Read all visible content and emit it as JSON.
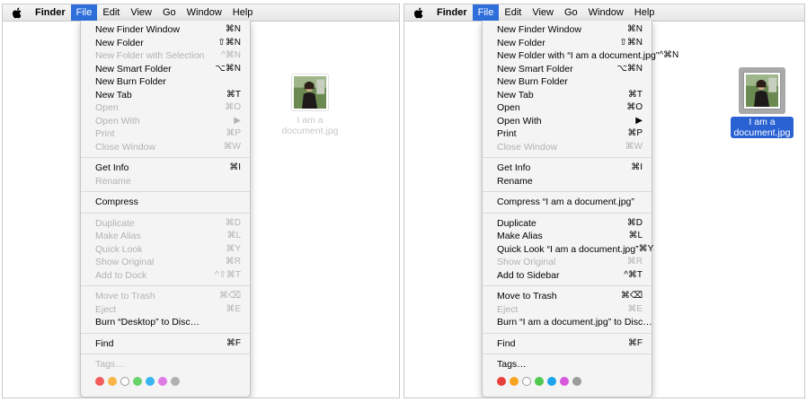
{
  "menubar": {
    "app": "Finder",
    "items": [
      "File",
      "Edit",
      "View",
      "Go",
      "Window",
      "Help"
    ]
  },
  "left": {
    "file_name_line1": "I am a",
    "file_name_line2": "document.jpg",
    "groups": [
      [
        {
          "label": "New Finder Window",
          "shortcut": "⌘N",
          "enabled": true
        },
        {
          "label": "New Folder",
          "shortcut": "⇧⌘N",
          "enabled": true
        },
        {
          "label": "New Folder with Selection",
          "shortcut": "^⌘N",
          "enabled": false
        },
        {
          "label": "New Smart Folder",
          "shortcut": "⌥⌘N",
          "enabled": true
        },
        {
          "label": "New Burn Folder",
          "shortcut": "",
          "enabled": true
        },
        {
          "label": "New Tab",
          "shortcut": "⌘T",
          "enabled": true
        },
        {
          "label": "Open",
          "shortcut": "⌘O",
          "enabled": false
        },
        {
          "label": "Open With",
          "shortcut": "▶",
          "enabled": false
        },
        {
          "label": "Print",
          "shortcut": "⌘P",
          "enabled": false
        },
        {
          "label": "Close Window",
          "shortcut": "⌘W",
          "enabled": false
        }
      ],
      [
        {
          "label": "Get Info",
          "shortcut": "⌘I",
          "enabled": true
        },
        {
          "label": "Rename",
          "shortcut": "",
          "enabled": false
        }
      ],
      [
        {
          "label": "Compress",
          "shortcut": "",
          "enabled": true
        }
      ],
      [
        {
          "label": "Duplicate",
          "shortcut": "⌘D",
          "enabled": false
        },
        {
          "label": "Make Alias",
          "shortcut": "⌘L",
          "enabled": false
        },
        {
          "label": "Quick Look",
          "shortcut": "⌘Y",
          "enabled": false
        },
        {
          "label": "Show Original",
          "shortcut": "⌘R",
          "enabled": false
        },
        {
          "label": "Add to Dock",
          "shortcut": "^⇧⌘T",
          "enabled": false
        }
      ],
      [
        {
          "label": "Move to Trash",
          "shortcut": "⌘⌫",
          "enabled": false
        },
        {
          "label": "Eject",
          "shortcut": "⌘E",
          "enabled": false
        },
        {
          "label": "Burn “Desktop” to Disc…",
          "shortcut": "",
          "enabled": true
        }
      ],
      [
        {
          "label": "Find",
          "shortcut": "⌘F",
          "enabled": true
        }
      ],
      [
        {
          "label": "Tags…",
          "shortcut": "",
          "enabled": false
        }
      ]
    ],
    "tag_colors": [
      "#f25c5c",
      "#f8b64a",
      "#ffffff",
      "#6ad36a",
      "#38b5f0",
      "#e07be6",
      "#b0b0b0"
    ]
  },
  "right": {
    "file_name_line1": "I am a",
    "file_name_line2": "document.jpg",
    "groups": [
      [
        {
          "label": "New Finder Window",
          "shortcut": "⌘N",
          "enabled": true
        },
        {
          "label": "New Folder",
          "shortcut": "⇧⌘N",
          "enabled": true
        },
        {
          "label": "New Folder with “I am a document.jpg”",
          "shortcut": "^⌘N",
          "enabled": true
        },
        {
          "label": "New Smart Folder",
          "shortcut": "⌥⌘N",
          "enabled": true
        },
        {
          "label": "New Burn Folder",
          "shortcut": "",
          "enabled": true
        },
        {
          "label": "New Tab",
          "shortcut": "⌘T",
          "enabled": true
        },
        {
          "label": "Open",
          "shortcut": "⌘O",
          "enabled": true
        },
        {
          "label": "Open With",
          "shortcut": "▶",
          "enabled": true
        },
        {
          "label": "Print",
          "shortcut": "⌘P",
          "enabled": true
        },
        {
          "label": "Close Window",
          "shortcut": "⌘W",
          "enabled": false
        }
      ],
      [
        {
          "label": "Get Info",
          "shortcut": "⌘I",
          "enabled": true
        },
        {
          "label": "Rename",
          "shortcut": "",
          "enabled": true
        }
      ],
      [
        {
          "label": "Compress “I am a document.jpg”",
          "shortcut": "",
          "enabled": true
        }
      ],
      [
        {
          "label": "Duplicate",
          "shortcut": "⌘D",
          "enabled": true
        },
        {
          "label": "Make Alias",
          "shortcut": "⌘L",
          "enabled": true
        },
        {
          "label": "Quick Look “I am a document.jpg”",
          "shortcut": "⌘Y",
          "enabled": true
        },
        {
          "label": "Show Original",
          "shortcut": "⌘R",
          "enabled": false
        },
        {
          "label": "Add to Sidebar",
          "shortcut": "^⌘T",
          "enabled": true
        }
      ],
      [
        {
          "label": "Move to Trash",
          "shortcut": "⌘⌫",
          "enabled": true
        },
        {
          "label": "Eject",
          "shortcut": "⌘E",
          "enabled": false
        },
        {
          "label": "Burn “I am a document.jpg” to Disc…",
          "shortcut": "",
          "enabled": true
        }
      ],
      [
        {
          "label": "Find",
          "shortcut": "⌘F",
          "enabled": true
        }
      ],
      [
        {
          "label": "Tags…",
          "shortcut": "",
          "enabled": true
        }
      ]
    ],
    "tag_colors": [
      "#e8403a",
      "#f7a521",
      "#ffffff",
      "#4fc94f",
      "#1ea4eb",
      "#d659dc",
      "#9c9c9c"
    ]
  },
  "colors": {
    "highlight": "#2e6fdb",
    "disabled_text": "#b2b2b2",
    "selection_label": "#2a62d3"
  }
}
